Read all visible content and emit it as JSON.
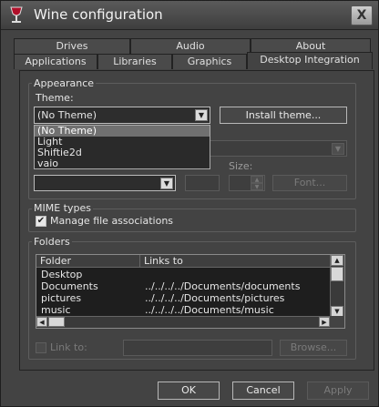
{
  "window": {
    "title": "Wine configuration",
    "close_label": "X"
  },
  "tabs_row1": [
    "Drives",
    "Audio",
    "About"
  ],
  "tabs_row2": [
    "Applications",
    "Libraries",
    "Graphics",
    "Desktop Integration"
  ],
  "appearance": {
    "group_title": "Appearance",
    "theme_label": "Theme:",
    "theme_value": "(No Theme)",
    "install_theme_label": "Install theme...",
    "theme_options": [
      "(No Theme)",
      "Light",
      "Shiftie2d",
      "vaio"
    ],
    "size_label": "Size:",
    "font_button_label": "Font..."
  },
  "mime": {
    "group_title": "MIME types",
    "manage_label": "Manage file associations",
    "checked": true
  },
  "folders": {
    "group_title": "Folders",
    "columns": [
      "Folder",
      "Links to"
    ],
    "rows": [
      {
        "folder": "Desktop",
        "link": ""
      },
      {
        "folder": "Documents",
        "link": "../../../../Documents/documents"
      },
      {
        "folder": "pictures",
        "link": "../../../../Documents/pictures"
      },
      {
        "folder": "music",
        "link": "../../../../Documents/music"
      }
    ],
    "link_to_label": "Link to:",
    "browse_label": "Browse..."
  },
  "footer": {
    "ok_label": "OK",
    "cancel_label": "Cancel",
    "apply_label": "Apply"
  }
}
